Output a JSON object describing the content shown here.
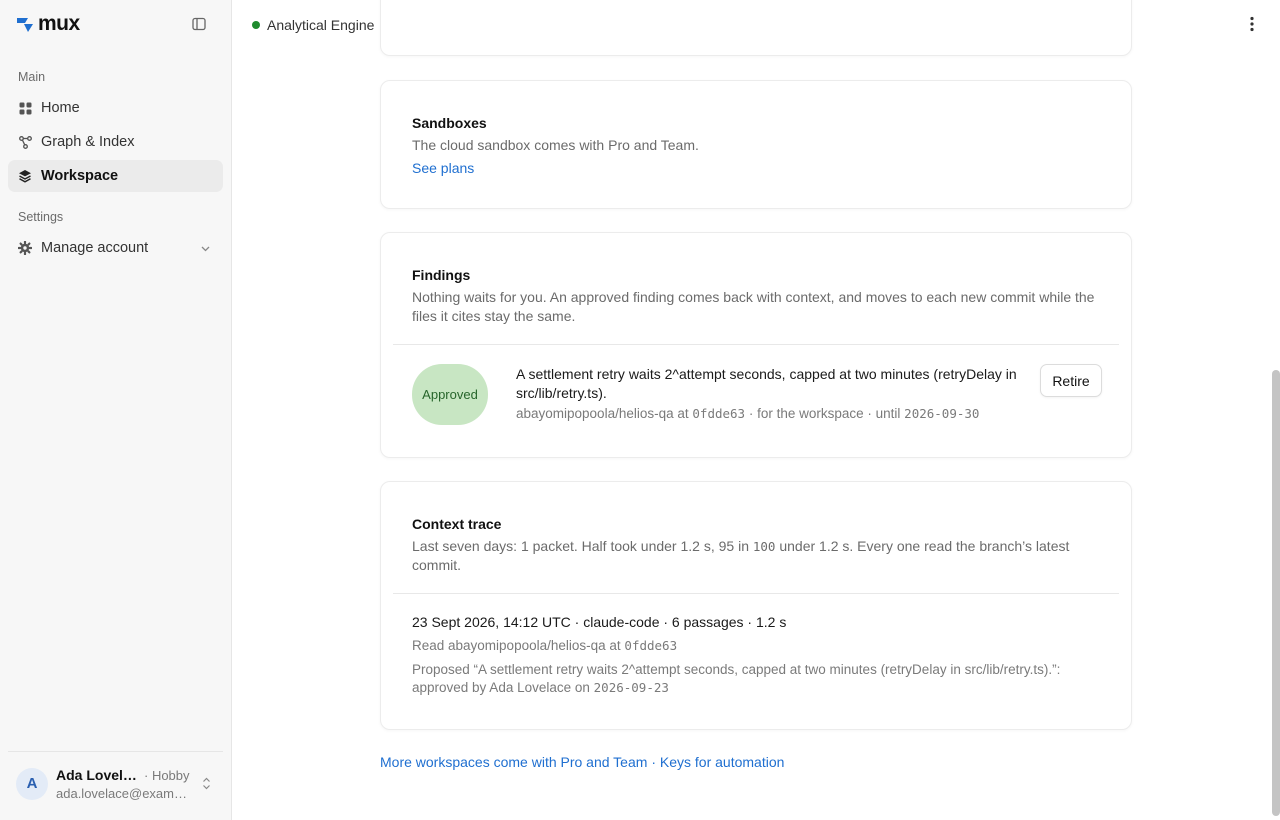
{
  "brand": {
    "name": "mux"
  },
  "sidebar": {
    "main_label": "Main",
    "items": [
      {
        "label": "Home",
        "icon": "grid-icon"
      },
      {
        "label": "Graph & Index",
        "icon": "graph-icon"
      },
      {
        "label": "Workspace",
        "icon": "layers-icon",
        "active": true
      }
    ],
    "settings_label": "Settings",
    "manage_account": {
      "label": "Manage account",
      "icon": "gear-icon"
    }
  },
  "user": {
    "initial": "A",
    "name": "Ada Lovelace",
    "plan": "· Hobby",
    "email": "ada.lovelace@example.com"
  },
  "header": {
    "project_name": "Analytical Engine",
    "status_color": "#1f8b2e"
  },
  "sandboxes": {
    "title": "Sandboxes",
    "description": "The cloud sandbox comes with Pro and Team.",
    "link": "See plans"
  },
  "findings": {
    "title": "Findings",
    "description": "Nothing waits for you. An approved finding comes back with context, and moves to each new commit while the files it cites stay the same.",
    "items": [
      {
        "status": "Approved",
        "text": "A settlement retry waits 2^attempt seconds, capped at two minutes (retryDelay in src/lib/retry.ts).",
        "repo_prefix": "abayomipopoola/helios-qa at",
        "commit": "0fdde63",
        "scope": "· for the workspace · until",
        "until": "2026-09-30",
        "action": "Retire"
      }
    ]
  },
  "context_trace": {
    "title": "Context trace",
    "desc_prefix": "Last seven days: 1 packet. Half took under 1.2 s, 95 in",
    "desc_num": "100",
    "desc_suffix": "under 1.2 s. Every one read the branch’s latest commit.",
    "entry": {
      "summary": "23 Sept 2026, 14:12 UTC · claude-code · 6 passages · 1.2 s",
      "read_prefix": "Read abayomipopoola/helios-qa at",
      "read_commit": "0fdde63",
      "proposed": "Proposed “A settlement retry waits 2^attempt seconds, capped at two minutes (retryDelay in src/lib/retry.ts).”: approved by Ada Lovelace on",
      "approved_date": "2026-09-23"
    }
  },
  "footer": {
    "link1": "More workspaces come with Pro and Team",
    "separator": "·",
    "link2": "Keys for automation"
  }
}
